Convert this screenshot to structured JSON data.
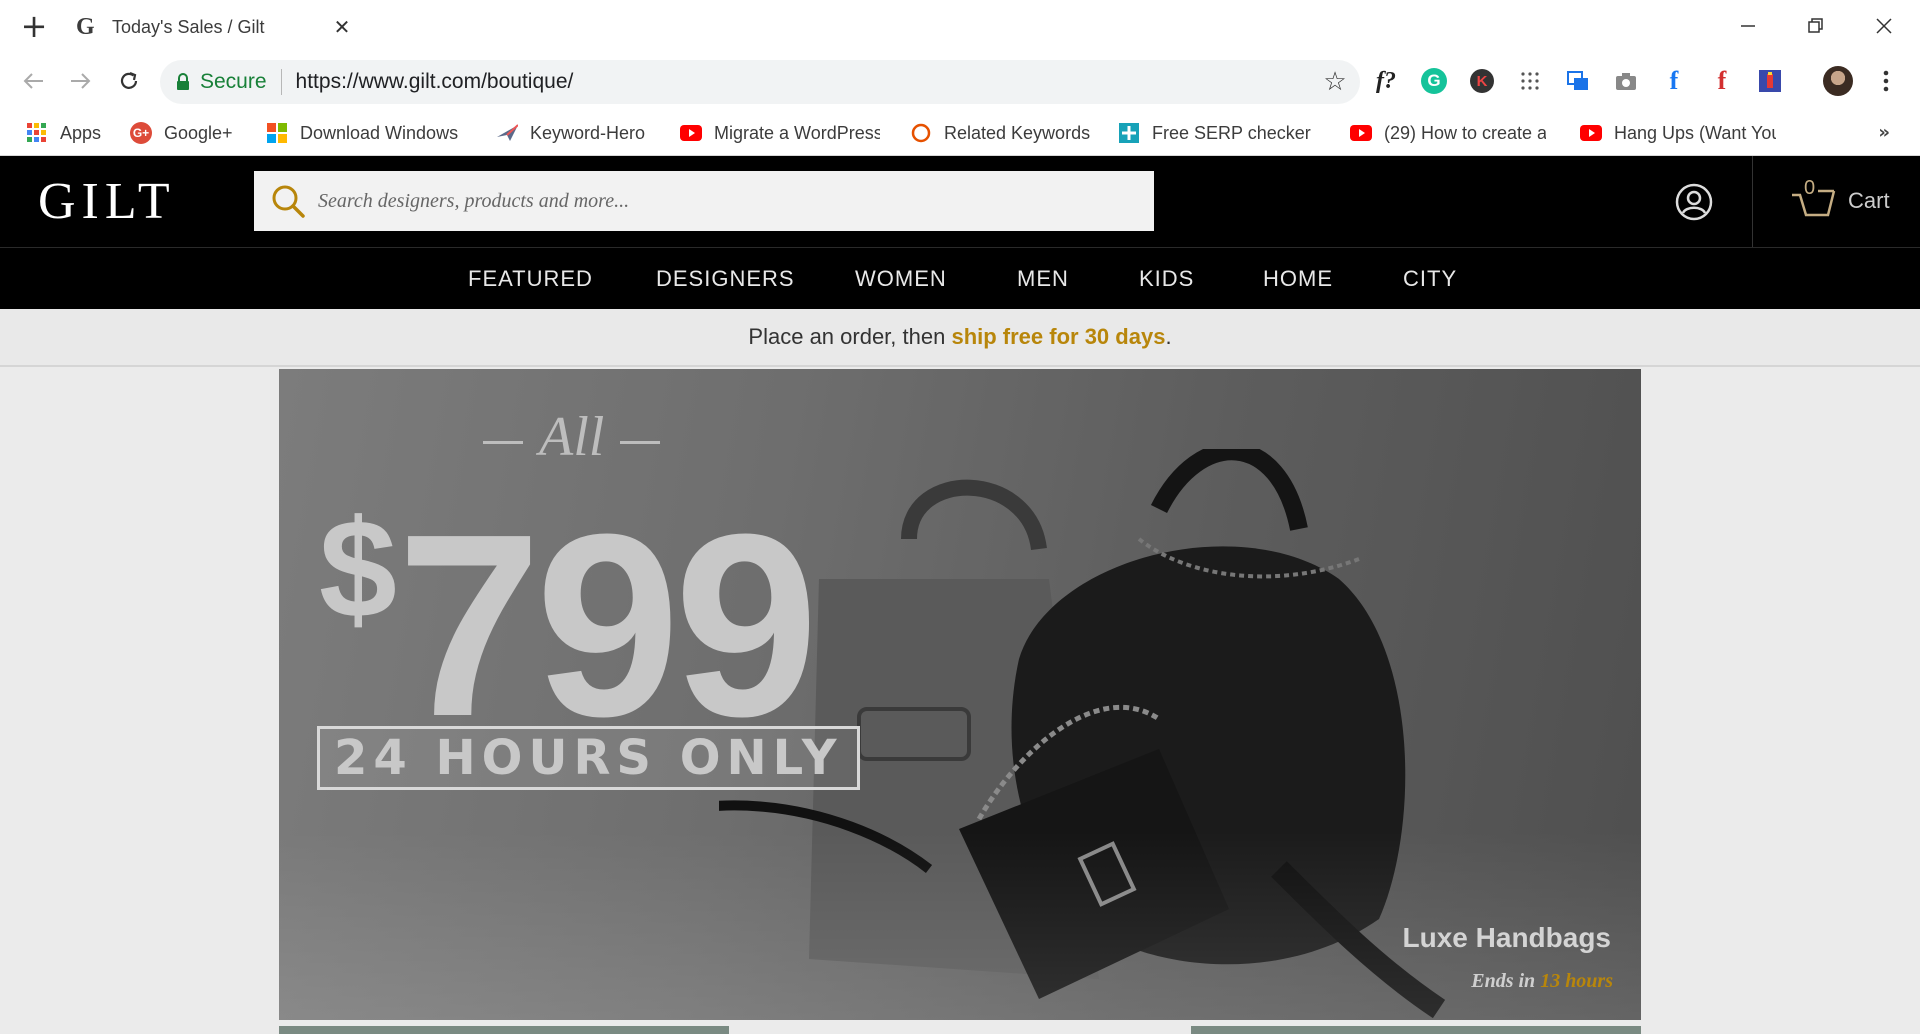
{
  "browser": {
    "tab_title": "Today's Sales / Gilt",
    "tab_favicon": "G",
    "secure_label": "Secure",
    "url": "https://www.gilt.com/boutique/",
    "extensions": [
      "f?",
      "G",
      "K"
    ],
    "bookmarks": [
      {
        "label": "Apps",
        "icon": "apps-grid-icon"
      },
      {
        "label": "Google+",
        "icon": "google-plus-icon"
      },
      {
        "label": "Download Windows",
        "icon": "windows-icon"
      },
      {
        "label": "Keyword-Hero",
        "icon": "keyword-hero-icon"
      },
      {
        "label": "Migrate a WordPress",
        "icon": "youtube-icon"
      },
      {
        "label": "Related Keywords",
        "icon": "ring-icon"
      },
      {
        "label": "Free SERP checker -",
        "icon": "serp-icon"
      },
      {
        "label": "(29) How to create a",
        "icon": "youtube-icon"
      },
      {
        "label": "Hang Ups (Want You",
        "icon": "youtube-icon"
      }
    ],
    "bookmarks_more": "»"
  },
  "gilt": {
    "logo": "GILT",
    "search_placeholder": "Search designers, products and more...",
    "cart_count": "0",
    "cart_label": "Cart",
    "nav": [
      "FEATURED",
      "DESIGNERS",
      "WOMEN",
      "MEN",
      "KIDS",
      "HOME",
      "CITY"
    ],
    "promo_prefix": "Place an order, then ",
    "promo_accent": "ship free for 30 days",
    "promo_suffix": "."
  },
  "hero": {
    "all_text": "All",
    "price_symbol": "$",
    "price_value": "799",
    "badge": "24 HOURS ONLY",
    "sale_title": "Luxe Handbags",
    "ends_prefix": "Ends in ",
    "ends_accent": "13 hours"
  },
  "colors": {
    "accent_gold": "#b8860b",
    "header_bg": "#000000",
    "secure_green": "#188038"
  }
}
